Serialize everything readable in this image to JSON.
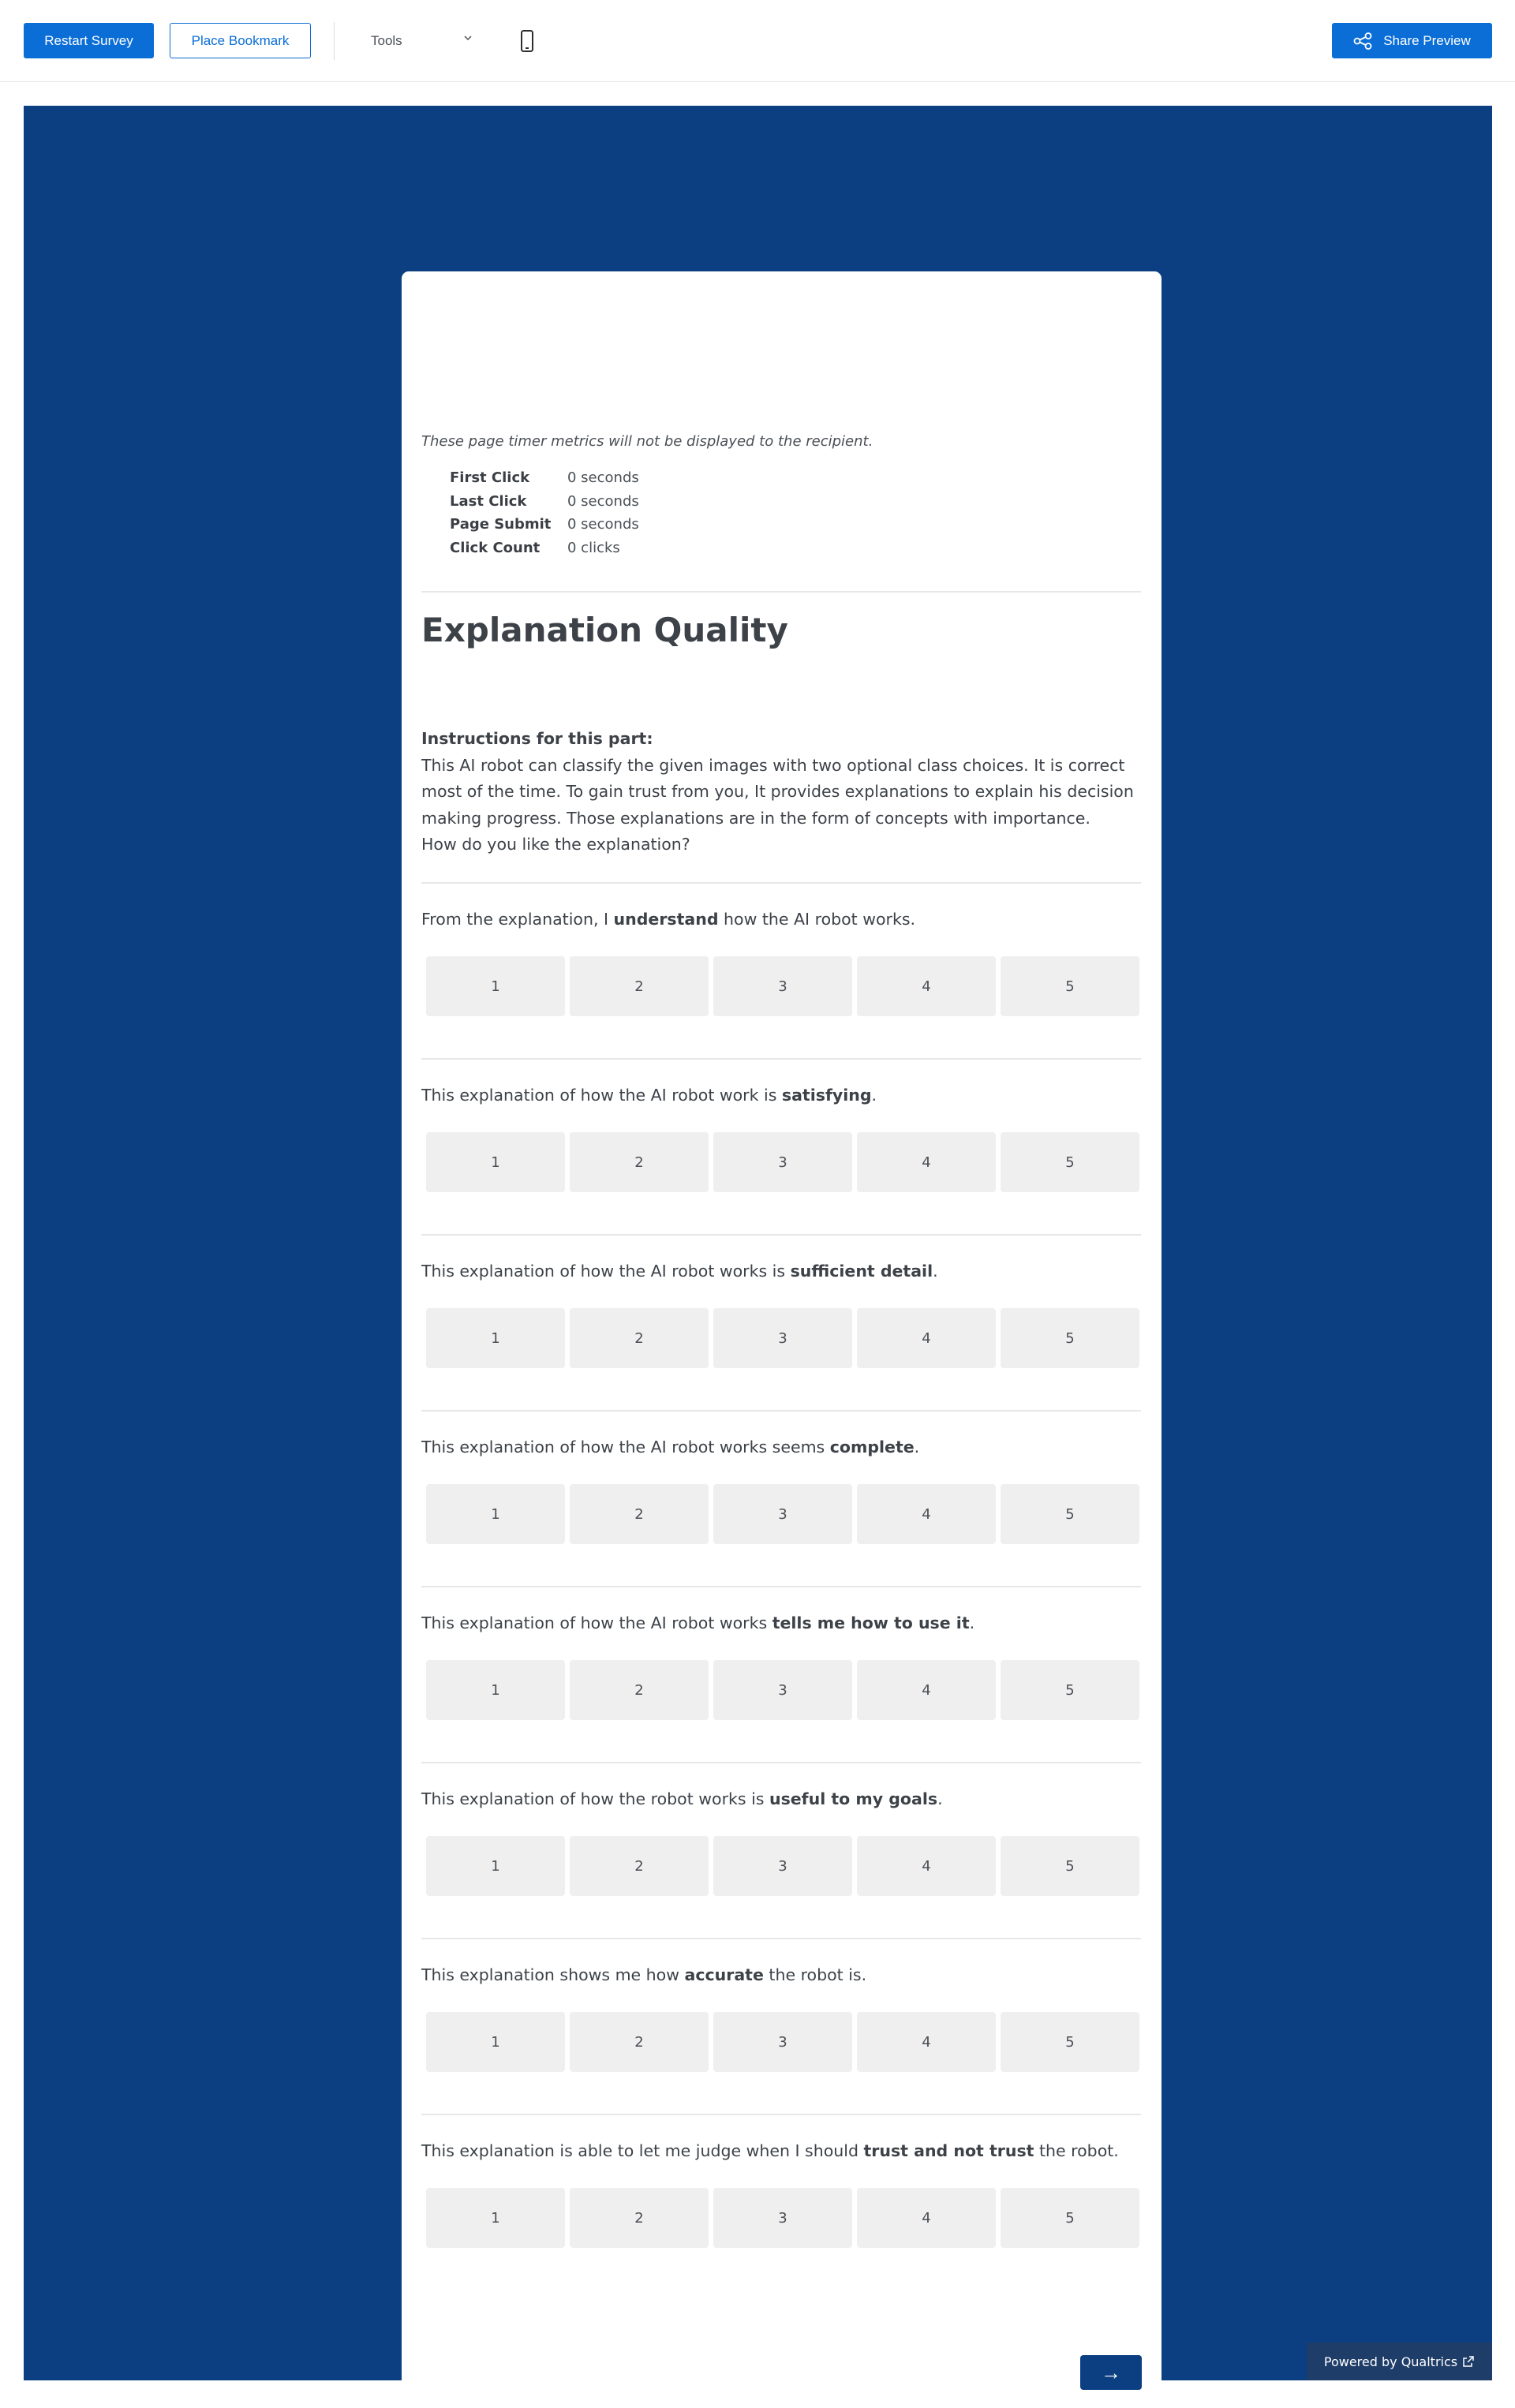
{
  "toolbar": {
    "restart_label": "Restart Survey",
    "bookmark_label": "Place Bookmark",
    "tools_label": "Tools",
    "share_label": "Share Preview"
  },
  "timer": {
    "note": "These page timer metrics will not be displayed to the recipient.",
    "rows": [
      {
        "label": "First Click",
        "value": "0 seconds"
      },
      {
        "label": "Last Click",
        "value": "0 seconds"
      },
      {
        "label": "Page Submit",
        "value": "0 seconds"
      },
      {
        "label": "Click Count",
        "value": "0 clicks"
      }
    ]
  },
  "section": {
    "title": "Explanation Quality"
  },
  "instructions": {
    "heading": "Instructions for this part:",
    "body": "This AI robot can classify the given images with two optional class choices. It is correct most of the time. To gain trust from you, It provides explanations to explain his decision making progress. Those explanations are in the form of concepts with importance.",
    "question": "How do you like the explanation?"
  },
  "scale_options": [
    "1",
    "2",
    "3",
    "4",
    "5"
  ],
  "questions": [
    {
      "pre": "From the explanation, I ",
      "bold": "understand",
      "post": " how the AI robot works."
    },
    {
      "pre": "This explanation of how the AI robot work is ",
      "bold": "satisfying",
      "post": "."
    },
    {
      "pre": "This explanation of how the AI robot works is ",
      "bold": "sufficient detail",
      "post": "."
    },
    {
      "pre": "This explanation of how the AI robot works seems ",
      "bold": "complete",
      "post": "."
    },
    {
      "pre": "This explanation of how the AI robot works ",
      "bold": "tells me how to use it",
      "post": "."
    },
    {
      "pre": "This explanation of how the robot works is ",
      "bold": "useful to my goals",
      "post": "."
    },
    {
      "pre": "This explanation shows me how ",
      "bold": "accurate",
      "post": " the robot is."
    },
    {
      "pre": "This explanation is able to let me judge when I should ",
      "bold": "trust and not trust",
      "post": " the robot."
    }
  ],
  "next_label": "→",
  "footer": {
    "powered_label": "Powered by Qualtrics"
  },
  "colors": {
    "primary": "#0b6ed6",
    "survey_background": "#0b3f82",
    "scale_button": "#efefef"
  }
}
